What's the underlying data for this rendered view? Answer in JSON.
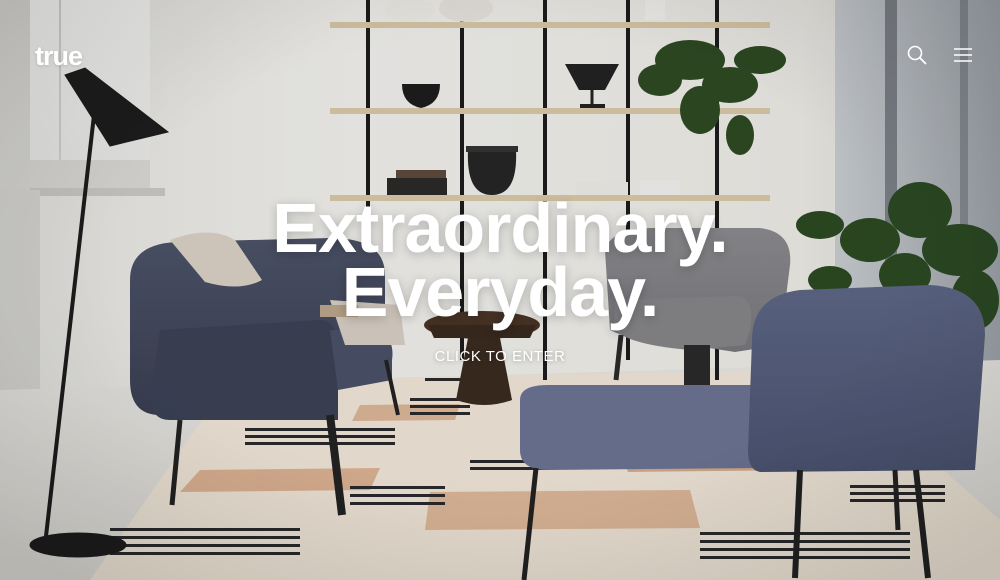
{
  "brand": {
    "logo_text": "true"
  },
  "header": {
    "search_icon": "search-icon",
    "menu_icon": "hamburger-menu-icon"
  },
  "hero": {
    "headline_line1": "Extraordinary.",
    "headline_line2": "Everyday.",
    "cta_label": "CLICK TO ENTER",
    "background_image": "living-room-interior-photo"
  },
  "colors": {
    "text": "#ffffff",
    "wall": "#ecebe7",
    "chair_fabric": "#4a5168",
    "rug_accent": "#d9a987"
  }
}
